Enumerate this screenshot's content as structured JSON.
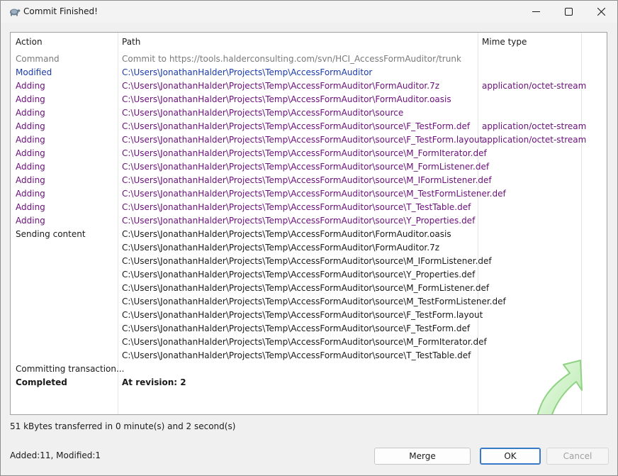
{
  "window": {
    "title": "Commit Finished!",
    "controls": {
      "minimize": "–",
      "maximize": "☐",
      "close": "✕"
    }
  },
  "list": {
    "headers": {
      "action": "Action",
      "path": "Path",
      "mime": "Mime type"
    },
    "rows": [
      {
        "action": "Command",
        "path": "Commit to https://tools.halderconsulting.com/svn/HCI_AccessFormAuditor/trunk",
        "mime": "",
        "style": "gray"
      },
      {
        "action": "Modified",
        "path": "C:\\Users\\JonathanHalder\\Projects\\Temp\\AccessFormAuditor",
        "mime": "",
        "style": "blue"
      },
      {
        "action": "Adding",
        "path": "C:\\Users\\JonathanHalder\\Projects\\Temp\\AccessFormAuditor\\FormAuditor.7z",
        "mime": "application/octet-stream",
        "style": "purple"
      },
      {
        "action": "Adding",
        "path": "C:\\Users\\JonathanHalder\\Projects\\Temp\\AccessFormAuditor\\FormAuditor.oasis",
        "mime": "",
        "style": "purple"
      },
      {
        "action": "Adding",
        "path": "C:\\Users\\JonathanHalder\\Projects\\Temp\\AccessFormAuditor\\source",
        "mime": "",
        "style": "purple"
      },
      {
        "action": "Adding",
        "path": "C:\\Users\\JonathanHalder\\Projects\\Temp\\AccessFormAuditor\\source\\F_TestForm.def",
        "mime": "application/octet-stream",
        "style": "purple"
      },
      {
        "action": "Adding",
        "path": "C:\\Users\\JonathanHalder\\Projects\\Temp\\AccessFormAuditor\\source\\F_TestForm.layout",
        "mime": "application/octet-stream",
        "style": "purple"
      },
      {
        "action": "Adding",
        "path": "C:\\Users\\JonathanHalder\\Projects\\Temp\\AccessFormAuditor\\source\\M_FormIterator.def",
        "mime": "",
        "style": "purple"
      },
      {
        "action": "Adding",
        "path": "C:\\Users\\JonathanHalder\\Projects\\Temp\\AccessFormAuditor\\source\\M_FormListener.def",
        "mime": "",
        "style": "purple"
      },
      {
        "action": "Adding",
        "path": "C:\\Users\\JonathanHalder\\Projects\\Temp\\AccessFormAuditor\\source\\M_IFormListener.def",
        "mime": "",
        "style": "purple"
      },
      {
        "action": "Adding",
        "path": "C:\\Users\\JonathanHalder\\Projects\\Temp\\AccessFormAuditor\\source\\M_TestFormListener.def",
        "mime": "",
        "style": "purple"
      },
      {
        "action": "Adding",
        "path": "C:\\Users\\JonathanHalder\\Projects\\Temp\\AccessFormAuditor\\source\\T_TestTable.def",
        "mime": "",
        "style": "purple"
      },
      {
        "action": "Adding",
        "path": "C:\\Users\\JonathanHalder\\Projects\\Temp\\AccessFormAuditor\\source\\Y_Properties.def",
        "mime": "",
        "style": "purple"
      },
      {
        "action": "Sending content",
        "path": "C:\\Users\\JonathanHalder\\Projects\\Temp\\AccessFormAuditor\\FormAuditor.oasis",
        "mime": "",
        "style": "black"
      },
      {
        "action": "",
        "path": "C:\\Users\\JonathanHalder\\Projects\\Temp\\AccessFormAuditor\\FormAuditor.7z",
        "mime": "",
        "style": "black"
      },
      {
        "action": "",
        "path": "C:\\Users\\JonathanHalder\\Projects\\Temp\\AccessFormAuditor\\source\\M_IFormListener.def",
        "mime": "",
        "style": "black"
      },
      {
        "action": "",
        "path": "C:\\Users\\JonathanHalder\\Projects\\Temp\\AccessFormAuditor\\source\\Y_Properties.def",
        "mime": "",
        "style": "black"
      },
      {
        "action": "",
        "path": "C:\\Users\\JonathanHalder\\Projects\\Temp\\AccessFormAuditor\\source\\M_FormListener.def",
        "mime": "",
        "style": "black"
      },
      {
        "action": "",
        "path": "C:\\Users\\JonathanHalder\\Projects\\Temp\\AccessFormAuditor\\source\\M_TestFormListener.def",
        "mime": "",
        "style": "black"
      },
      {
        "action": "",
        "path": "C:\\Users\\JonathanHalder\\Projects\\Temp\\AccessFormAuditor\\source\\F_TestForm.layout",
        "mime": "",
        "style": "black"
      },
      {
        "action": "",
        "path": "C:\\Users\\JonathanHalder\\Projects\\Temp\\AccessFormAuditor\\source\\F_TestForm.def",
        "mime": "",
        "style": "black"
      },
      {
        "action": "",
        "path": "C:\\Users\\JonathanHalder\\Projects\\Temp\\AccessFormAuditor\\source\\M_FormIterator.def",
        "mime": "",
        "style": "black"
      },
      {
        "action": "",
        "path": "C:\\Users\\JonathanHalder\\Projects\\Temp\\AccessFormAuditor\\source\\T_TestTable.def",
        "mime": "",
        "style": "black"
      },
      {
        "action": "Committing transaction...",
        "path": "",
        "mime": "",
        "style": "black"
      },
      {
        "action": "Completed",
        "path": "At revision: 2",
        "mime": "",
        "style": "bold"
      }
    ]
  },
  "status": {
    "transfer": "51 kBytes transferred in 0 minute(s) and 2 second(s)",
    "counts": "Added:11, Modified:1"
  },
  "buttons": {
    "merge": "Merge",
    "ok": "OK",
    "cancel": "Cancel"
  },
  "colors": {
    "gray": "#7a7a7a",
    "blue": "#1a3aa8",
    "purple": "#6a0f7a",
    "black": "#1a1a1a",
    "accent": "#3778c7",
    "arrow_green": "#c9f0c0"
  },
  "icons": {
    "app": "tortoise-icon",
    "decoration": "curved-arrow-icon"
  }
}
